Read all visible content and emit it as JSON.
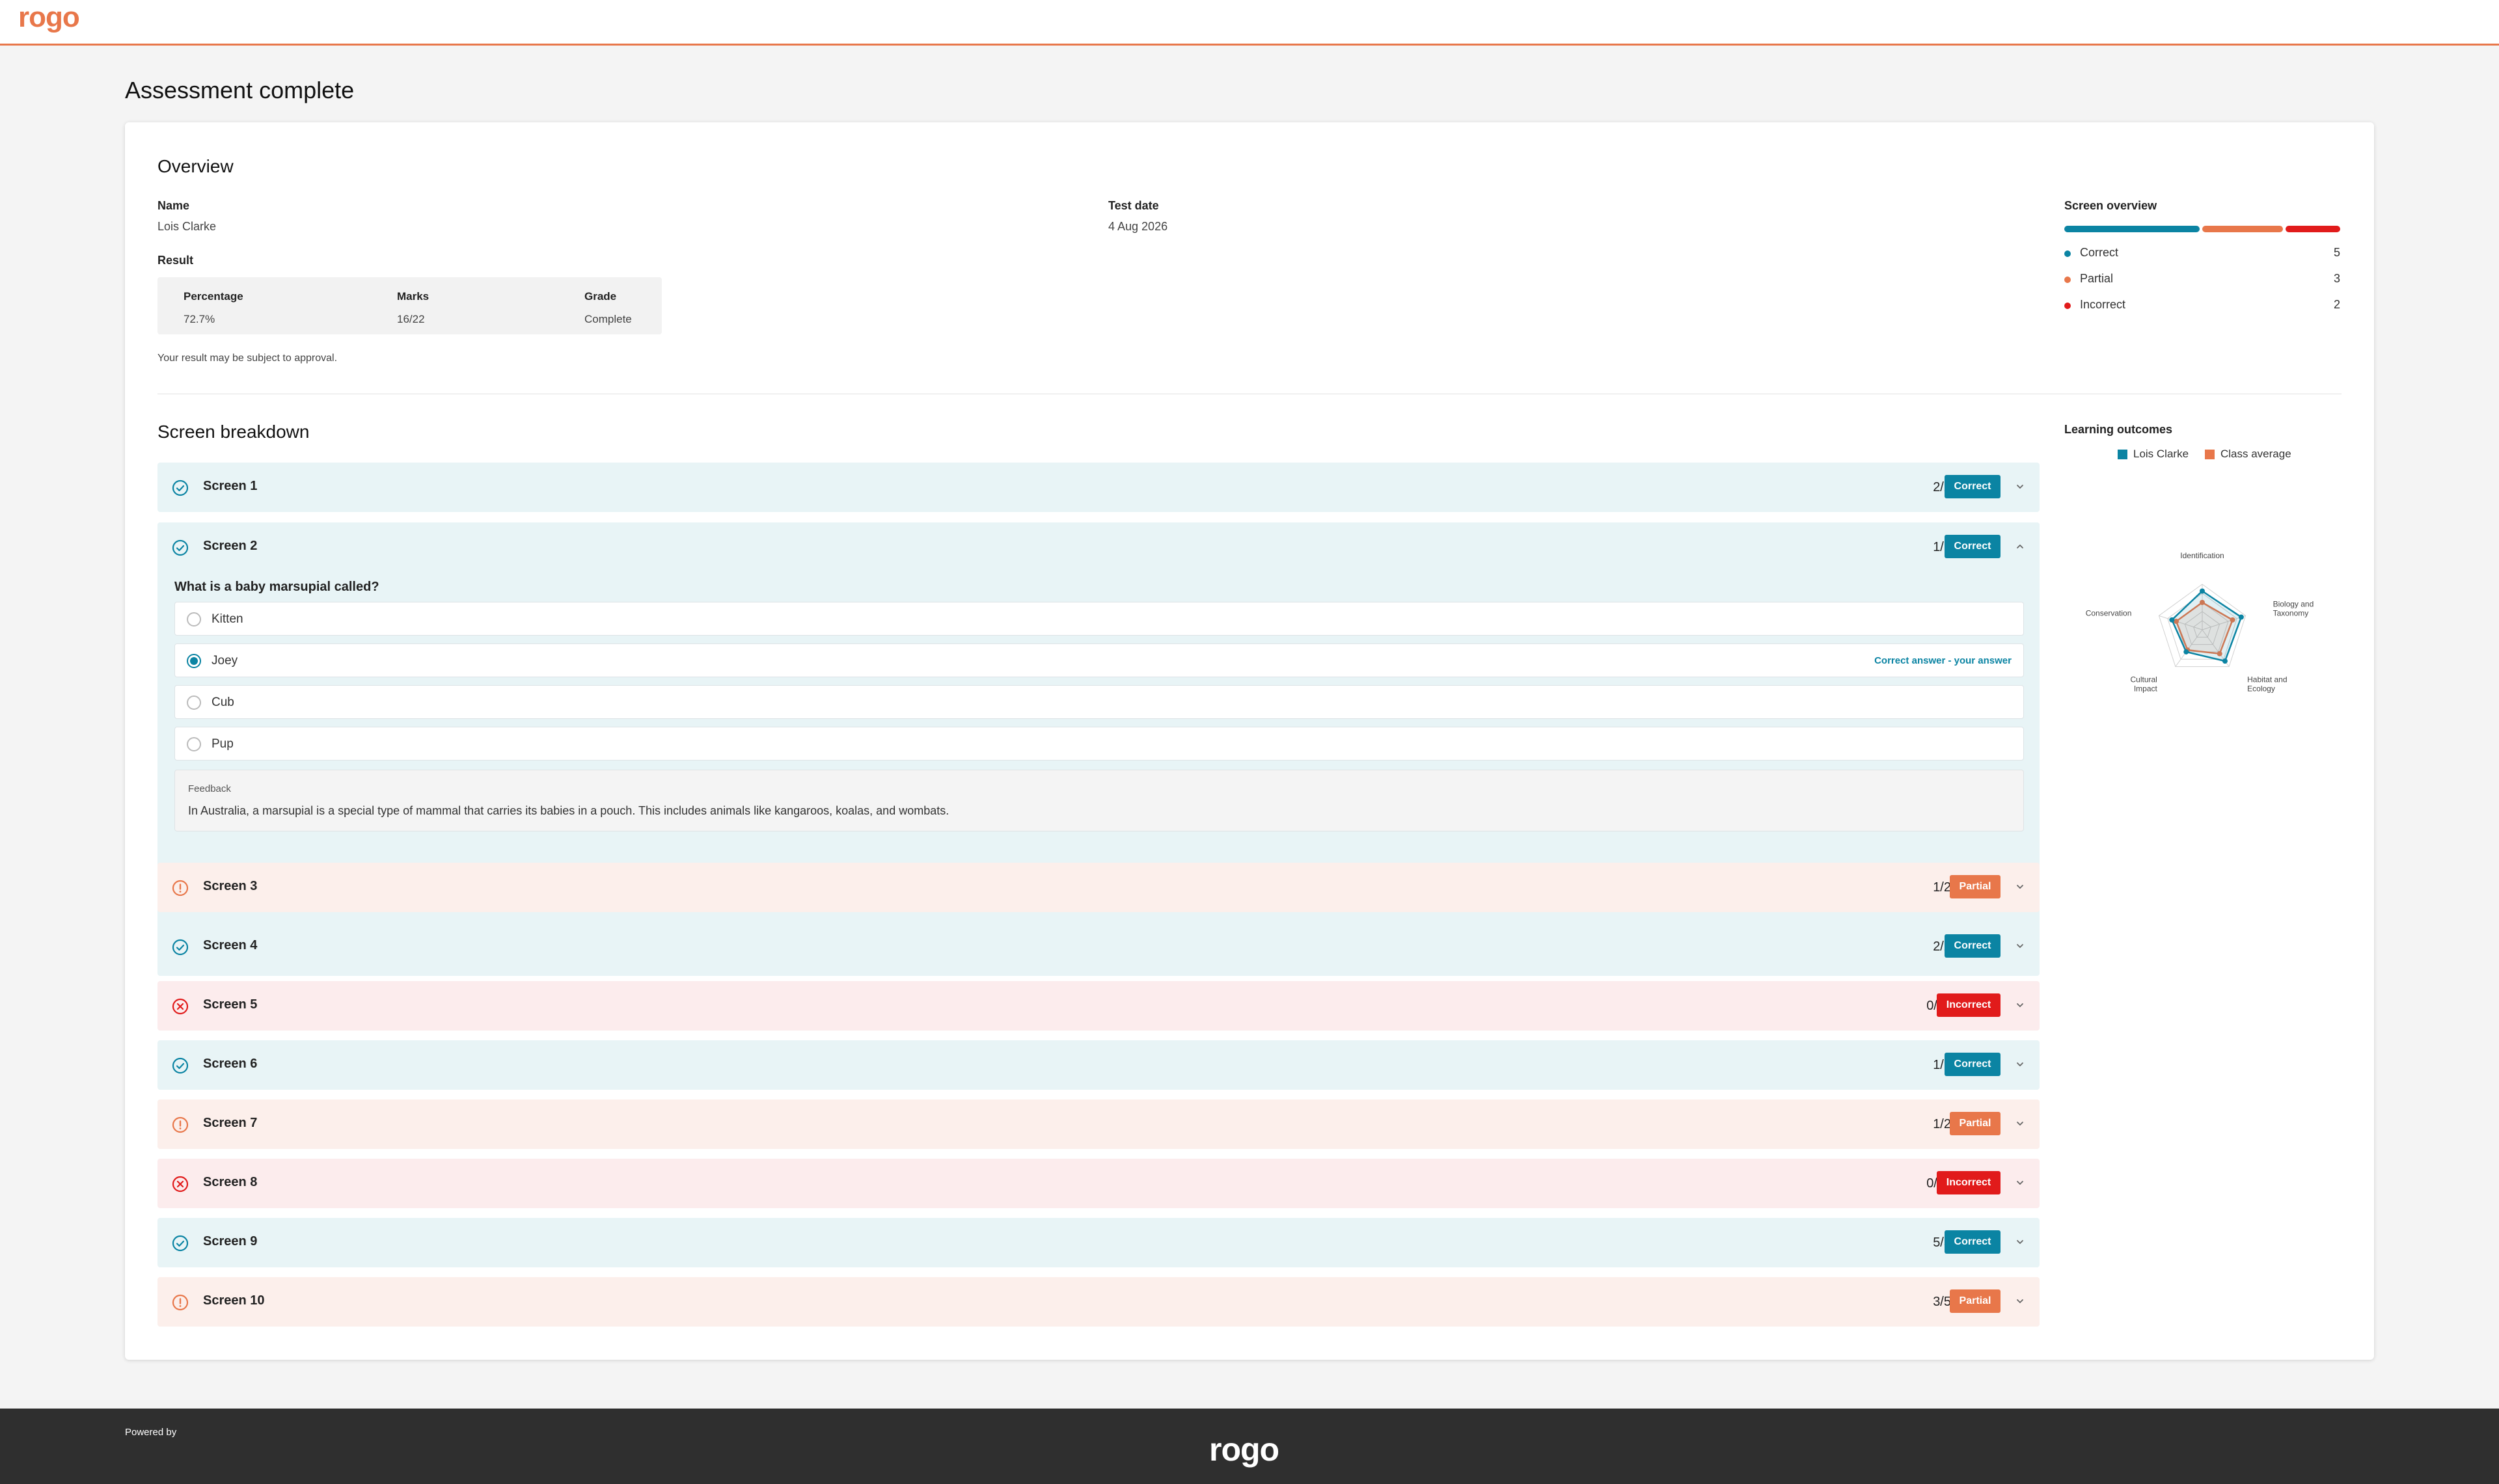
{
  "header": {
    "logo_text": "rogo",
    "brand_color": "#e8774a"
  },
  "page": {
    "title": "Assessment complete"
  },
  "overview": {
    "heading": "Overview",
    "name_label": "Name",
    "name_value": "Lois Clarke",
    "date_label": "Test date",
    "date_value": "4 Aug 2026",
    "result_label": "Result",
    "percentage_label": "Percentage",
    "percentage_value": "72.7%",
    "marks_label": "Marks",
    "marks_value": "16/22",
    "grade_label": "Grade",
    "grade_value": "Complete",
    "note": "Your result may be subject to approval."
  },
  "screen_overview": {
    "title": "Screen overview",
    "items": [
      {
        "label": "Correct",
        "count": "5",
        "color": "#0b84a3"
      },
      {
        "label": "Partial",
        "count": "3",
        "color": "#e8774a"
      },
      {
        "label": "Incorrect",
        "count": "2",
        "color": "#e11b1b"
      }
    ]
  },
  "breakdown": {
    "heading": "Screen breakdown",
    "screens": [
      {
        "title": "Screen 1",
        "score": "2/2",
        "status": "Correct",
        "expanded": false
      },
      {
        "title": "Screen 2",
        "score": "1/1",
        "status": "Correct",
        "expanded": true
      },
      {
        "title": "Screen 3",
        "score": "1/2",
        "status": "Partial",
        "expanded": false
      },
      {
        "title": "Screen 4",
        "score": "2/2",
        "status": "Correct",
        "expanded": false
      },
      {
        "title": "Screen 5",
        "score": "0/1",
        "status": "Incorrect",
        "expanded": false
      },
      {
        "title": "Screen 6",
        "score": "1/1",
        "status": "Correct",
        "expanded": false
      },
      {
        "title": "Screen 7",
        "score": "1/2",
        "status": "Partial",
        "expanded": false
      },
      {
        "title": "Screen 8",
        "score": "0/1",
        "status": "Incorrect",
        "expanded": false
      },
      {
        "title": "Screen 9",
        "score": "5/5",
        "status": "Correct",
        "expanded": false
      },
      {
        "title": "Screen 10",
        "score": "3/5",
        "status": "Partial",
        "expanded": false
      }
    ],
    "question": {
      "text": "What is a baby marsupial called?",
      "options": [
        "Kitten",
        "Joey",
        "Cub",
        "Pup"
      ],
      "selected": "Joey",
      "answer_note": "Correct answer - your answer",
      "feedback_label": "Feedback",
      "feedback_text": "In Australia, a marsupial is a special type of mammal that carries its babies in a pouch. This includes animals like kangaroos, koalas, and wombats."
    }
  },
  "learning_outcomes": {
    "title": "Learning outcomes",
    "legend": [
      {
        "label": "Lois Clarke",
        "color": "#0b84a3"
      },
      {
        "label": "Class average",
        "color": "#e8774a"
      }
    ]
  },
  "chart_data": {
    "type": "radar",
    "axes": [
      "Identification",
      "Biology and Taxonomy",
      "Habitat and Ecology",
      "Cultural Impact",
      "Conservation"
    ],
    "series": [
      {
        "name": "Lois Clarke",
        "values": [
          0.85,
          0.9,
          0.85,
          0.6,
          0.7
        ]
      },
      {
        "name": "Class average",
        "values": [
          0.6,
          0.7,
          0.65,
          0.55,
          0.6
        ]
      }
    ],
    "range": [
      0,
      1
    ],
    "grid_levels": 5
  },
  "footer": {
    "powered_by": "Powered by",
    "logo_text": "rogo"
  }
}
